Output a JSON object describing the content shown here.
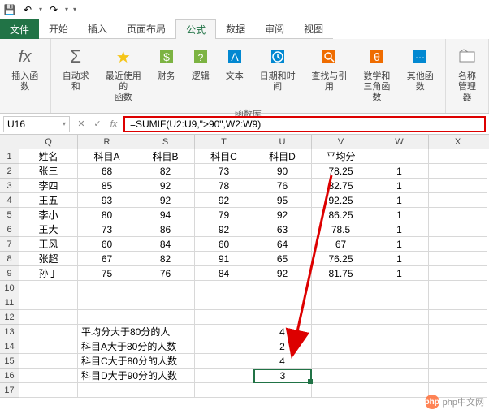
{
  "qat": {
    "save_icon": "💾",
    "undo_icon": "↶",
    "redo_icon": "↷"
  },
  "tabs": {
    "file": "文件",
    "home": "开始",
    "insert": "插入",
    "layout": "页面布局",
    "formulas": "公式",
    "data": "数据",
    "review": "审阅",
    "view": "视图"
  },
  "ribbon": {
    "insert_func": "插入函数",
    "autosum": "自动求和",
    "recent": "最近使用的\n函数",
    "financial": "财务",
    "logical": "逻辑",
    "text": "文本",
    "datetime": "日期和时间",
    "lookup": "查找与引用",
    "math": "数学和\n三角函数",
    "more": "其他函数",
    "name_mgr": "名称\n管理器",
    "group_label": "函数库"
  },
  "formula_bar": {
    "name_box": "U16",
    "cancel": "✕",
    "confirm": "✓",
    "fx": "fx",
    "formula": "=SUMIF(U2:U9,\">90\",W2:W9)"
  },
  "grid": {
    "cols": [
      "Q",
      "R",
      "S",
      "T",
      "U",
      "V",
      "W",
      "X"
    ],
    "rows": [
      [
        "姓名",
        "科目A",
        "科目B",
        "科目C",
        "科目D",
        "平均分",
        "",
        ""
      ],
      [
        "张三",
        "68",
        "82",
        "73",
        "90",
        "78.25",
        "1",
        ""
      ],
      [
        "李四",
        "85",
        "92",
        "78",
        "76",
        "82.75",
        "1",
        ""
      ],
      [
        "王五",
        "93",
        "92",
        "92",
        "95",
        "92.25",
        "1",
        ""
      ],
      [
        "李小",
        "80",
        "94",
        "79",
        "92",
        "86.25",
        "1",
        ""
      ],
      [
        "王大",
        "73",
        "86",
        "92",
        "63",
        "78.5",
        "1",
        ""
      ],
      [
        "王风",
        "60",
        "84",
        "60",
        "64",
        "67",
        "1",
        ""
      ],
      [
        "张超",
        "67",
        "82",
        "91",
        "65",
        "76.25",
        "1",
        ""
      ],
      [
        "孙丁",
        "75",
        "76",
        "84",
        "92",
        "81.75",
        "1",
        ""
      ],
      [
        "",
        "",
        "",
        "",
        "",
        "",
        "",
        ""
      ],
      [
        "",
        "",
        "",
        "",
        "",
        "",
        "",
        ""
      ],
      [
        "",
        "",
        "",
        "",
        "",
        "",
        "",
        ""
      ],
      [
        "",
        "平均分大于80分的人",
        "",
        "",
        "4",
        "",
        "",
        ""
      ],
      [
        "",
        "科目A大于80分的人数",
        "",
        "",
        "2",
        "",
        "",
        ""
      ],
      [
        "",
        "科目C大于80分的人数",
        "",
        "",
        "4",
        "",
        "",
        ""
      ],
      [
        "",
        "科目D大于90分的人数",
        "",
        "",
        "3",
        "",
        "",
        ""
      ],
      [
        "",
        "",
        "",
        "",
        "",
        "",
        "",
        ""
      ]
    ],
    "selected_row": 16,
    "selected_col": "U"
  },
  "watermark": {
    "logo": "php",
    "text": "php中文网"
  }
}
